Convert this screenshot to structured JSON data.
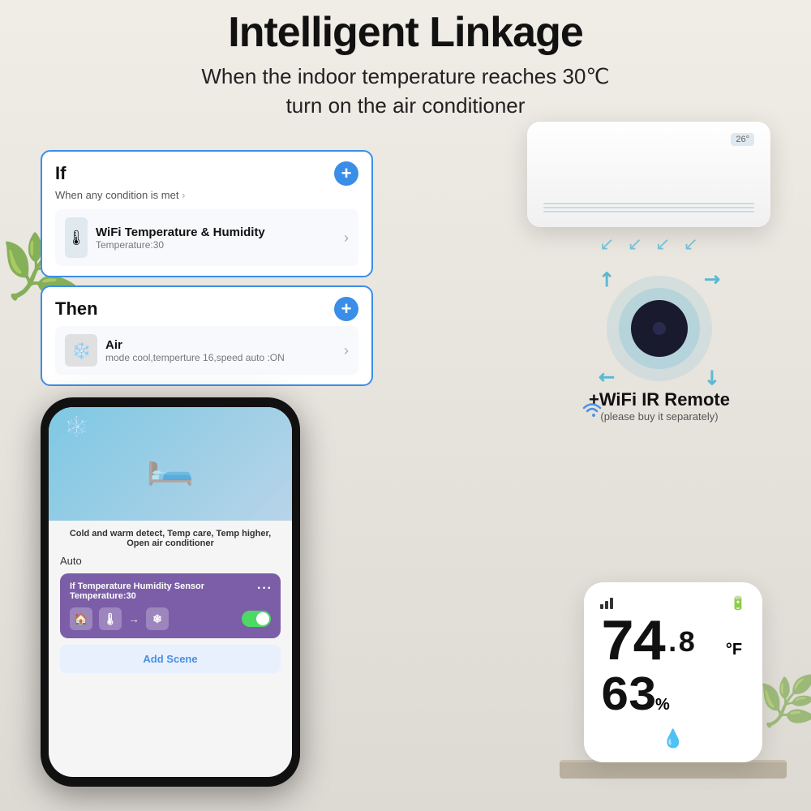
{
  "header": {
    "main_title": "Intelligent Linkage",
    "subtitle_line1": "When the indoor temperature reaches 30℃",
    "subtitle_line2": "turn on the air conditioner"
  },
  "if_card": {
    "title": "If",
    "condition_label": "When any condition is met",
    "add_btn_label": "+",
    "sensor_name": "WiFi Temperature & Humidity",
    "sensor_sub": "Temperature:30"
  },
  "then_card": {
    "title": "Then",
    "add_btn_label": "+",
    "device_name": "Air",
    "device_sub": "mode cool,temperture 16,speed auto :ON"
  },
  "phone": {
    "desc_text": "Cold and warm detect, Temp care, Temp higher, Open air conditioner",
    "auto_label": "Auto",
    "card_title": "If Temperature Humidity Sensor",
    "card_sub": "Temperature:30",
    "add_scene_label": "Add Scene"
  },
  "ir_remote": {
    "label": "+WiFi IR Remote",
    "sublabel": "(please buy it separately)"
  },
  "sensor": {
    "temp_value": "74",
    "temp_decimal": ".8",
    "temp_unit": "°F",
    "humidity_value": "63",
    "humidity_unit": "%"
  }
}
